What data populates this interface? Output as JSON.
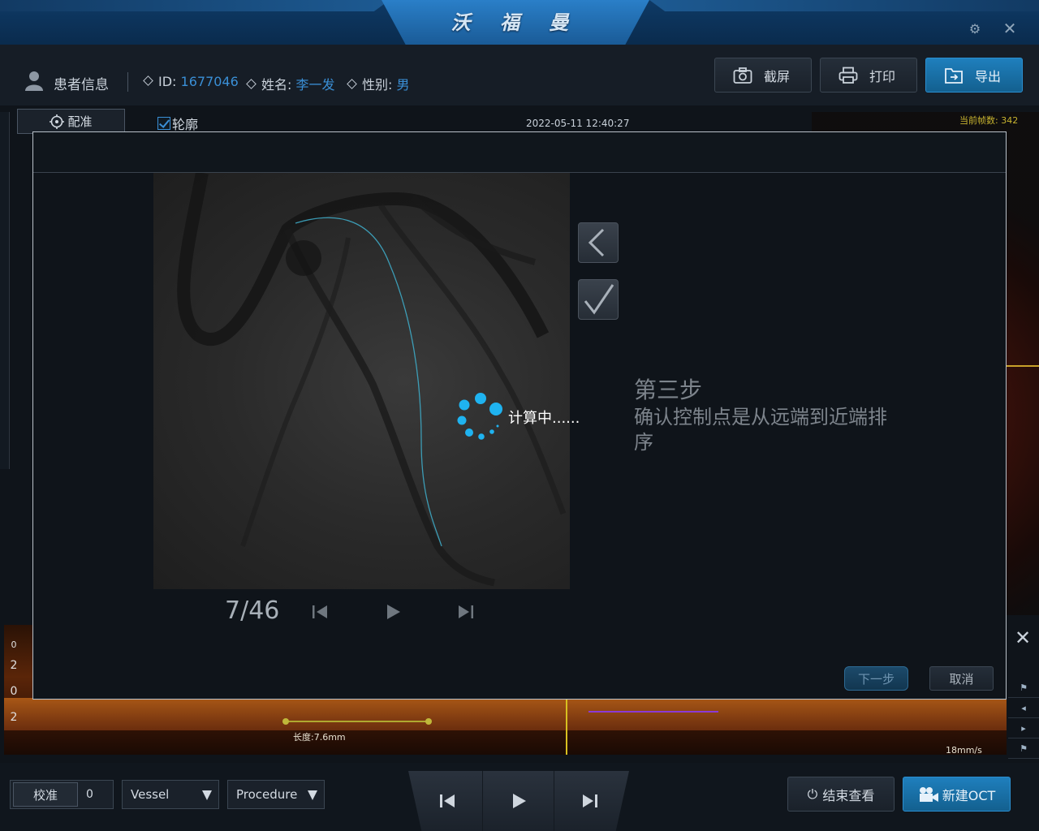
{
  "app": {
    "brand": "沃 福 曼"
  },
  "patient": {
    "section_title": "患者信息",
    "id_label": "ID:",
    "id_value": "1677046",
    "name_label": "姓名:",
    "name_value": "李一发",
    "gender_label": "性别:",
    "gender_value": "男"
  },
  "toolbar": {
    "screenshot_label": "截屏",
    "print_label": "打印",
    "export_label": "导出"
  },
  "workspace": {
    "register_label": "配准",
    "contour_label": "轮廓",
    "contour_checked": true,
    "datetime": "2022-05-11 12:40:27",
    "frame_count_label": "当前帧数: 342",
    "length_label": "长度:7.6mm",
    "speed_label": "18mm/s",
    "axis_ticks": [
      "0",
      "2",
      "0",
      "2"
    ]
  },
  "modal": {
    "loading_text": "计算中......",
    "step_title": "第三步",
    "step_desc": "确认控制点是从远端到近端排序",
    "frame_indicator": "7/46",
    "next_label": "下一步",
    "cancel_label": "取消"
  },
  "bottom": {
    "calibrate_label": "校准",
    "calibrate_value": "0",
    "vessel_select": "Vessel",
    "procedure_select": "Procedure",
    "end_review_label": "结束查看",
    "new_oct_label": "新建OCT"
  },
  "colors": {
    "accent": "#3a8fd6",
    "spinner": "#1fb3f0",
    "frame_count": "#c8b430"
  }
}
